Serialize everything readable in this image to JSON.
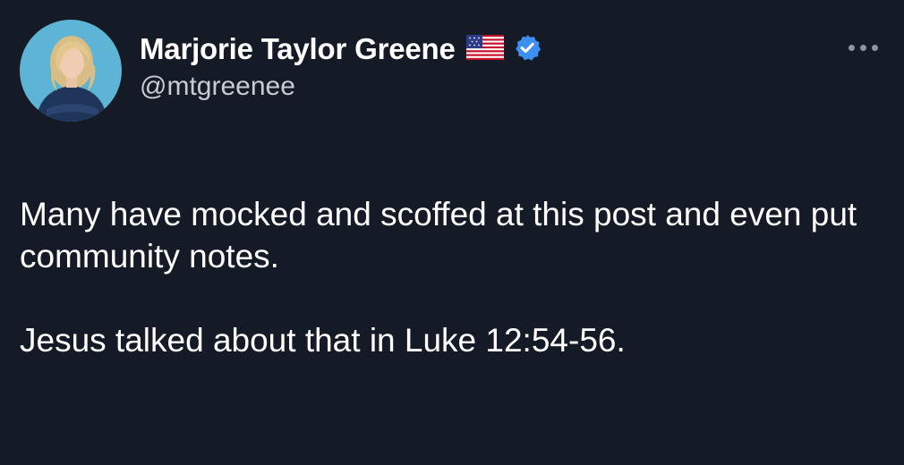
{
  "author": {
    "display_name": "Marjorie Taylor Greene",
    "handle": "@mtgreenee",
    "flag_icon": "us-flag-icon",
    "verified_icon": "verified-badge-icon",
    "verified_color": "#3d8ff2"
  },
  "menu": {
    "more_icon": "more-options-icon"
  },
  "tweet": {
    "paragraphs": [
      "Many have mocked and scoffed at this post and even put community notes.",
      "Jesus talked about that in Luke 12:54-56."
    ]
  },
  "colors": {
    "background": "#151b26",
    "text": "#ffffff",
    "secondary_text": "#c7ccd3",
    "avatar_bg": "#5db4d4"
  }
}
